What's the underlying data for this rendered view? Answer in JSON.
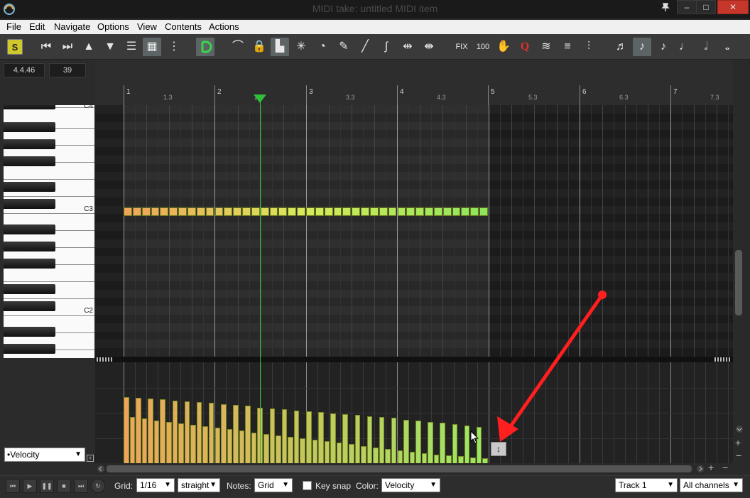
{
  "window": {
    "title": "MIDI take: untitled MIDI item"
  },
  "menu": [
    "File",
    "Edit",
    "Navigate",
    "Options",
    "View",
    "Contents",
    "Actions"
  ],
  "toolbar": {
    "s_label": "S",
    "fix_label": "FIX",
    "hundred_label": "100",
    "q_label": "Q"
  },
  "left": {
    "position": "4.4.46",
    "value": "39",
    "octaves": [
      "C4",
      "C3",
      "C2"
    ],
    "lane_select": "•Velocity",
    "lane_add": "+"
  },
  "ruler": {
    "bars": [
      "1",
      "2",
      "3",
      "4",
      "5",
      "6",
      "7"
    ],
    "subs": [
      "1.3",
      "2.3",
      "3.3",
      "4.3",
      "5.3",
      "6.3",
      "7.3"
    ]
  },
  "notes": {
    "count": 40,
    "colors": {
      "start": "#f0a45a",
      "mid": "#d7ea5a",
      "end": "#8ee65c"
    }
  },
  "velocity": {
    "pairs": [
      [
        0.61,
        0.88
      ],
      [
        0.59,
        0.87
      ],
      [
        0.57,
        0.86
      ],
      [
        0.55,
        0.85
      ],
      [
        0.53,
        0.83
      ],
      [
        0.51,
        0.82
      ],
      [
        0.49,
        0.81
      ],
      [
        0.47,
        0.8
      ],
      [
        0.45,
        0.78
      ],
      [
        0.43,
        0.77
      ],
      [
        0.41,
        0.76
      ],
      [
        0.39,
        0.74
      ],
      [
        0.37,
        0.73
      ],
      [
        0.35,
        0.72
      ],
      [
        0.33,
        0.7
      ],
      [
        0.31,
        0.69
      ],
      [
        0.29,
        0.68
      ],
      [
        0.27,
        0.66
      ],
      [
        0.25,
        0.65
      ],
      [
        0.23,
        0.64
      ],
      [
        0.21,
        0.62
      ],
      [
        0.19,
        0.61
      ],
      [
        0.17,
        0.6
      ],
      [
        0.15,
        0.58
      ],
      [
        0.13,
        0.57
      ],
      [
        0.11,
        0.55
      ],
      [
        0.1,
        0.54
      ],
      [
        0.09,
        0.52
      ],
      [
        0.08,
        0.5
      ],
      [
        0.07,
        0.48
      ]
    ],
    "colors": {
      "start": "#f0a45a",
      "end": "#9ae865"
    }
  },
  "bottom": {
    "grid_label": "Grid:",
    "grid_value": "1/16",
    "grid_mode": "straight",
    "notes_label": "Notes:",
    "notes_value": "Grid",
    "keysnap_label": "Key snap",
    "color_label": "Color:",
    "color_value": "Velocity",
    "track_value": "Track 1",
    "channel_value": "All channels"
  },
  "annotation": {
    "arrow_color": "#ff1f1f"
  }
}
